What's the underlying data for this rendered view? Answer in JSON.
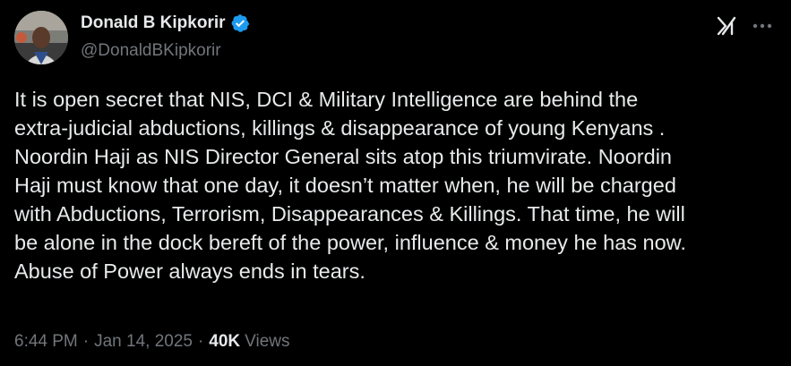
{
  "author": {
    "name": "Donald B Kipkorir",
    "handle": "@DonaldBKipkorir",
    "verified": true
  },
  "icons": {
    "header_right": [
      "grok-icon",
      "more-options-icon"
    ],
    "verified": "verified-badge-icon"
  },
  "tweet": {
    "lines": [
      "It is open secret that NIS, DCI & Military Intelligence are behind the",
      "extra-judicial abductions, killings & disappearance of young Kenyans .",
      "Noordin Haji as NIS Director General sits atop this triumvirate. Noordin",
      "Haji must know that one day, it doesn’t matter when, he will be charged",
      "with Abductions, Terrorism, Disappearances & Killings. That time, he will",
      "be alone in the dock bereft of the power, influence & money he has now.",
      "Abuse of Power always ends in tears."
    ]
  },
  "meta": {
    "time": "6:44 PM",
    "separator": "·",
    "date": "Jan 14, 2025",
    "views_count": "40K",
    "views_label": "Views"
  },
  "colors": {
    "background": "#000000",
    "text_primary": "#e7e9ea",
    "text_secondary": "#71767b",
    "verified_blue": "#1d9bf0"
  }
}
